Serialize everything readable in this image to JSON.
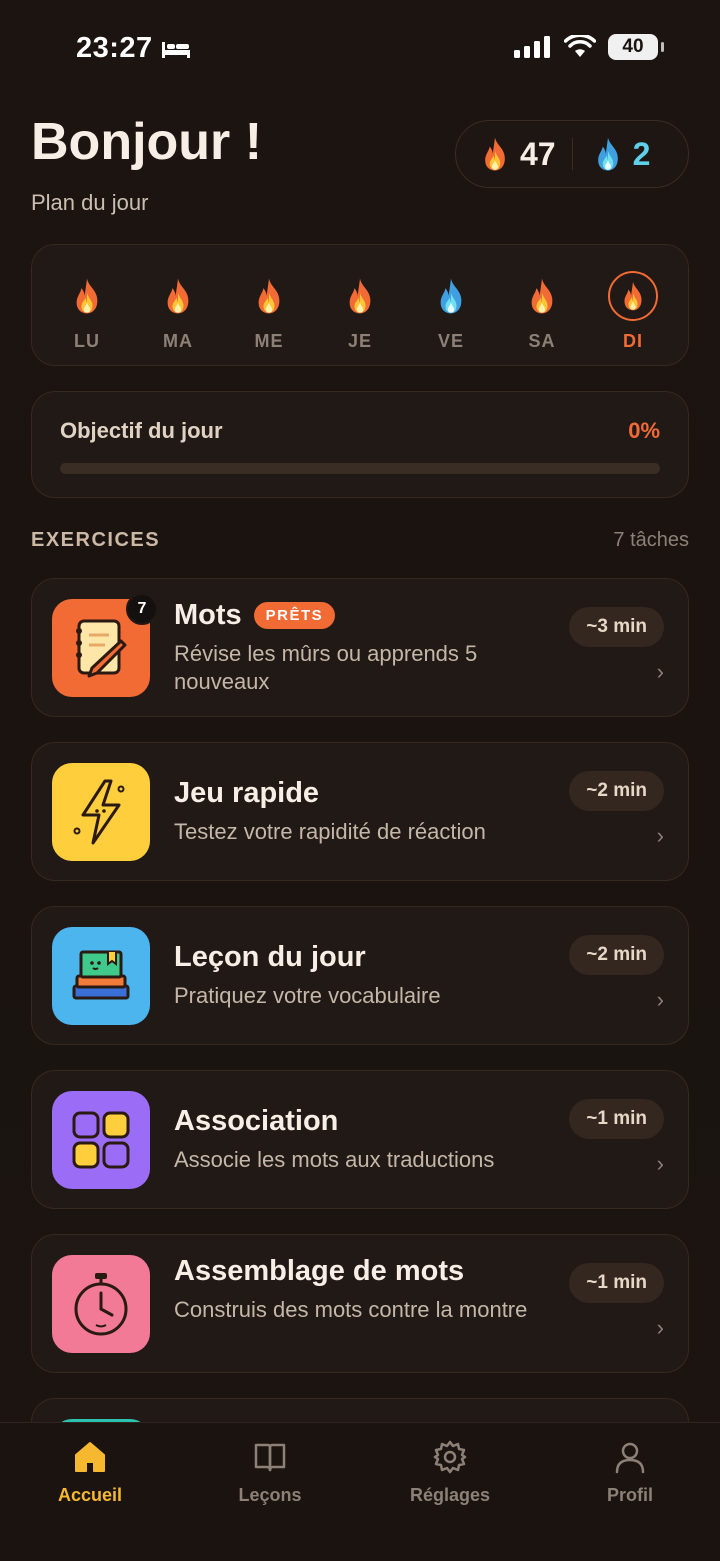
{
  "status": {
    "time": "23:27",
    "battery": "40"
  },
  "header": {
    "greeting": "Bonjour !",
    "subtitle": "Plan du jour",
    "streak_fire": "47",
    "streak_freeze": "2"
  },
  "week": [
    {
      "label": "LU",
      "type": "fire"
    },
    {
      "label": "MA",
      "type": "fire"
    },
    {
      "label": "ME",
      "type": "fire"
    },
    {
      "label": "JE",
      "type": "fire"
    },
    {
      "label": "VE",
      "type": "freeze"
    },
    {
      "label": "SA",
      "type": "fire"
    },
    {
      "label": "DI",
      "type": "fire-active"
    }
  ],
  "goal": {
    "title": "Objectif du jour",
    "percent_label": "0%",
    "progress": 0
  },
  "exercises": {
    "title": "EXERCICES",
    "count": "7 tâches",
    "items": [
      {
        "title": "Mots",
        "badge": "PRÊTS",
        "count": "7",
        "desc": "Révise les mûrs ou apprends 5 nouveaux",
        "duration": "~3 min",
        "icon": "notebook-pencil-icon",
        "color": "#f26a34"
      },
      {
        "title": "Jeu rapide",
        "desc": "Testez votre rapidité de réaction",
        "duration": "~2 min",
        "icon": "lightning-icon",
        "color": "#ffce3d"
      },
      {
        "title": "Leçon du jour",
        "desc": "Pratiquez votre vocabulaire",
        "duration": "~2 min",
        "icon": "books-stack-icon",
        "color": "#4cb5ee"
      },
      {
        "title": "Association",
        "desc": "Associe les mots aux traductions",
        "duration": "~1 min",
        "icon": "grid-squares-icon",
        "color": "#9b6cf5"
      },
      {
        "title": "Assemblage de mots",
        "desc": "Construis des mots contre la montre",
        "duration": "~1 min",
        "icon": "stopwatch-icon",
        "color": "#f27a96"
      }
    ]
  },
  "nav": [
    {
      "label": "Accueil",
      "icon": "home-icon",
      "active": true
    },
    {
      "label": "Leçons",
      "icon": "book-icon",
      "active": false
    },
    {
      "label": "Réglages",
      "icon": "gear-icon",
      "active": false
    },
    {
      "label": "Profil",
      "icon": "user-icon",
      "active": false
    }
  ],
  "colors": {
    "accent": "#f26a34",
    "nav_active": "#f5b82e",
    "freeze": "#5fd0ea"
  }
}
